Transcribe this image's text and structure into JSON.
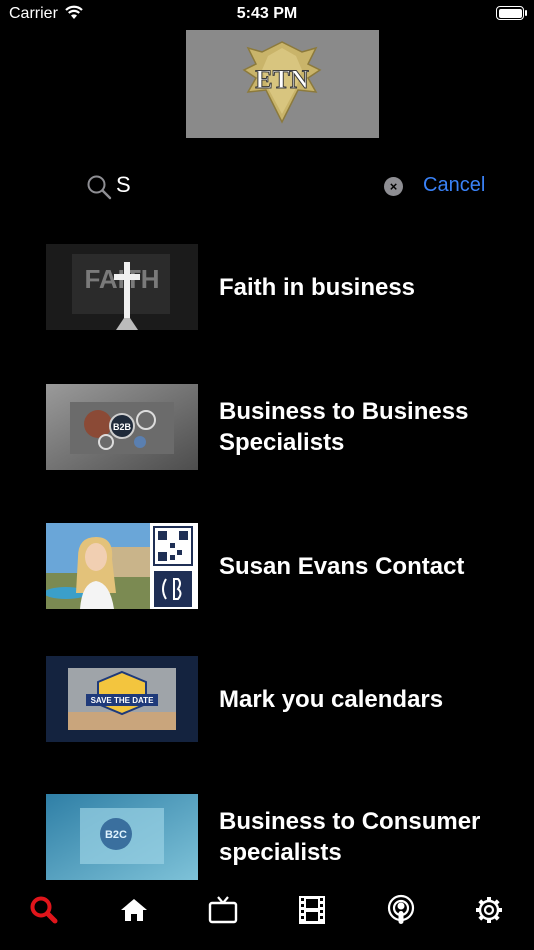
{
  "status_bar": {
    "carrier": "Carrier",
    "time": "5:43 PM"
  },
  "header": {
    "logo_text": "ETN"
  },
  "search": {
    "value": "S",
    "cancel_label": "Cancel"
  },
  "results": [
    {
      "title": "Faith in business",
      "thumb_text": "FAITH"
    },
    {
      "title": "Business to Business Specialists",
      "thumb_text": "B2B"
    },
    {
      "title": "Susan Evans Contact"
    },
    {
      "title": "Mark you calendars",
      "thumb_text": "SAVE THE DATE"
    },
    {
      "title": "Business to Consumer specialists",
      "thumb_text": "B2C"
    }
  ],
  "tabbar": {
    "active_color": "#e0151b",
    "items": [
      "search-icon",
      "home-icon",
      "tv-icon",
      "film-icon",
      "podcast-icon",
      "gear-icon"
    ]
  }
}
